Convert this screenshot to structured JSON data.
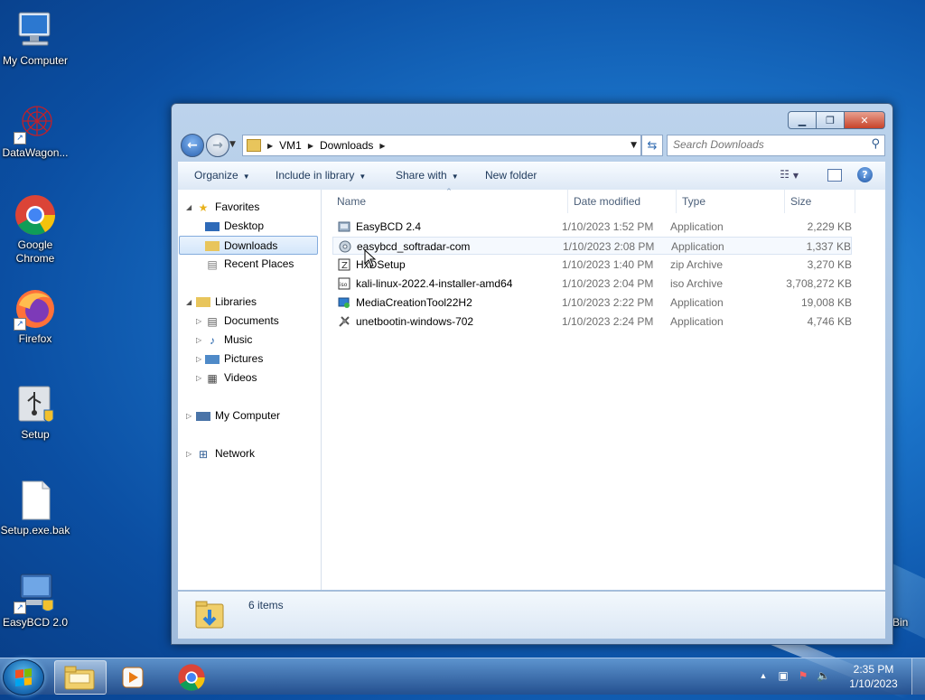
{
  "desktop": {
    "icons": [
      {
        "label": "My Computer",
        "icon": "computer-icon"
      },
      {
        "label": "DataWagon...",
        "icon": "datawagon-icon"
      },
      {
        "label": "Google Chrome",
        "icon": "chrome-icon"
      },
      {
        "label": "Firefox",
        "icon": "firefox-icon"
      },
      {
        "label": "Setup",
        "icon": "usb-setup-icon"
      },
      {
        "label": "Setup.exe.bak",
        "icon": "file-icon"
      },
      {
        "label": "EasyBCD 2.0",
        "icon": "easybcd-icon"
      }
    ],
    "recycle_partial": "Bin"
  },
  "window": {
    "address": {
      "crumbs": [
        "VM1",
        "Downloads"
      ]
    },
    "search_placeholder": "Search Downloads",
    "commands": {
      "organize": "Organize",
      "include": "Include in library",
      "share": "Share with",
      "new_folder": "New folder"
    },
    "nav": {
      "favorites": "Favorites",
      "desktop": "Desktop",
      "downloads": "Downloads",
      "recent": "Recent Places",
      "libraries": "Libraries",
      "documents": "Documents",
      "music": "Music",
      "pictures": "Pictures",
      "videos": "Videos",
      "computer": "My Computer",
      "network": "Network"
    },
    "columns": {
      "name": "Name",
      "date": "Date modified",
      "type": "Type",
      "size": "Size"
    },
    "files": [
      {
        "name": "EasyBCD 2.4",
        "date": "1/10/2023 1:52 PM",
        "type": "Application",
        "size": "2,229 KB",
        "icon": "setup-app-icon"
      },
      {
        "name": "easybcd_softradar-com",
        "date": "1/10/2023 2:08 PM",
        "type": "Application",
        "size": "1,337 KB",
        "icon": "disc-app-icon"
      },
      {
        "name": "HxDSetup",
        "date": "1/10/2023 1:40 PM",
        "type": "zip Archive",
        "size": "3,270 KB",
        "icon": "zip-icon"
      },
      {
        "name": "kali-linux-2022.4-installer-amd64",
        "date": "1/10/2023 2:04 PM",
        "type": "iso Archive",
        "size": "3,708,272 KB",
        "icon": "iso-icon"
      },
      {
        "name": "MediaCreationTool22H2",
        "date": "1/10/2023 2:22 PM",
        "type": "Application",
        "size": "19,008 KB",
        "icon": "media-tool-icon"
      },
      {
        "name": "unetbootin-windows-702",
        "date": "1/10/2023 2:24 PM",
        "type": "Application",
        "size": "4,746 KB",
        "icon": "unetbootin-icon"
      }
    ],
    "status": {
      "count": "6 items"
    }
  },
  "taskbar": {
    "clock_time": "2:35 PM",
    "clock_date": "1/10/2023"
  }
}
